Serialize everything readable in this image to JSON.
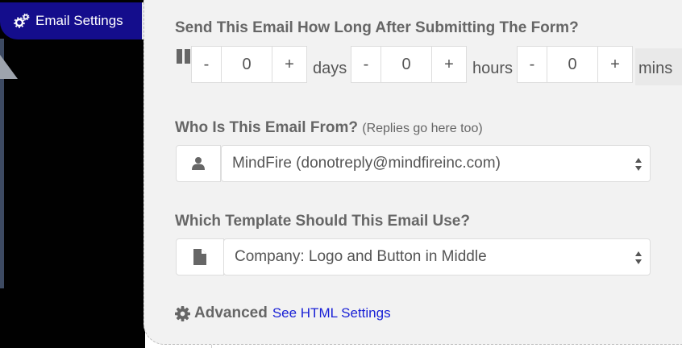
{
  "tab": {
    "label": "Email Settings",
    "icon": "cogs-icon"
  },
  "delay": {
    "question": "Send This Email How Long After Submitting The Form?",
    "days": {
      "value": "0",
      "unit": "days"
    },
    "hours": {
      "value": "0",
      "unit": "hours"
    },
    "mins": {
      "value": "0",
      "unit": "mins"
    },
    "minus": "-",
    "plus": "+"
  },
  "from": {
    "question": "Who Is This Email From?",
    "sub": "(Replies go here too)",
    "selected": "MindFire (donotreply@mindfireinc.com)",
    "icon": "user-icon"
  },
  "template": {
    "question": "Which Template Should This Email Use?",
    "selected": "Company: Logo and Button in Middle",
    "icon": "file-icon"
  },
  "advanced": {
    "label": "Advanced",
    "link": "See HTML Settings",
    "icon": "gear-icon"
  },
  "colors": {
    "tab_bg": "#140d8c",
    "panel_bg": "#f2f2f2",
    "link": "#1a21d6",
    "text": "#666666"
  }
}
